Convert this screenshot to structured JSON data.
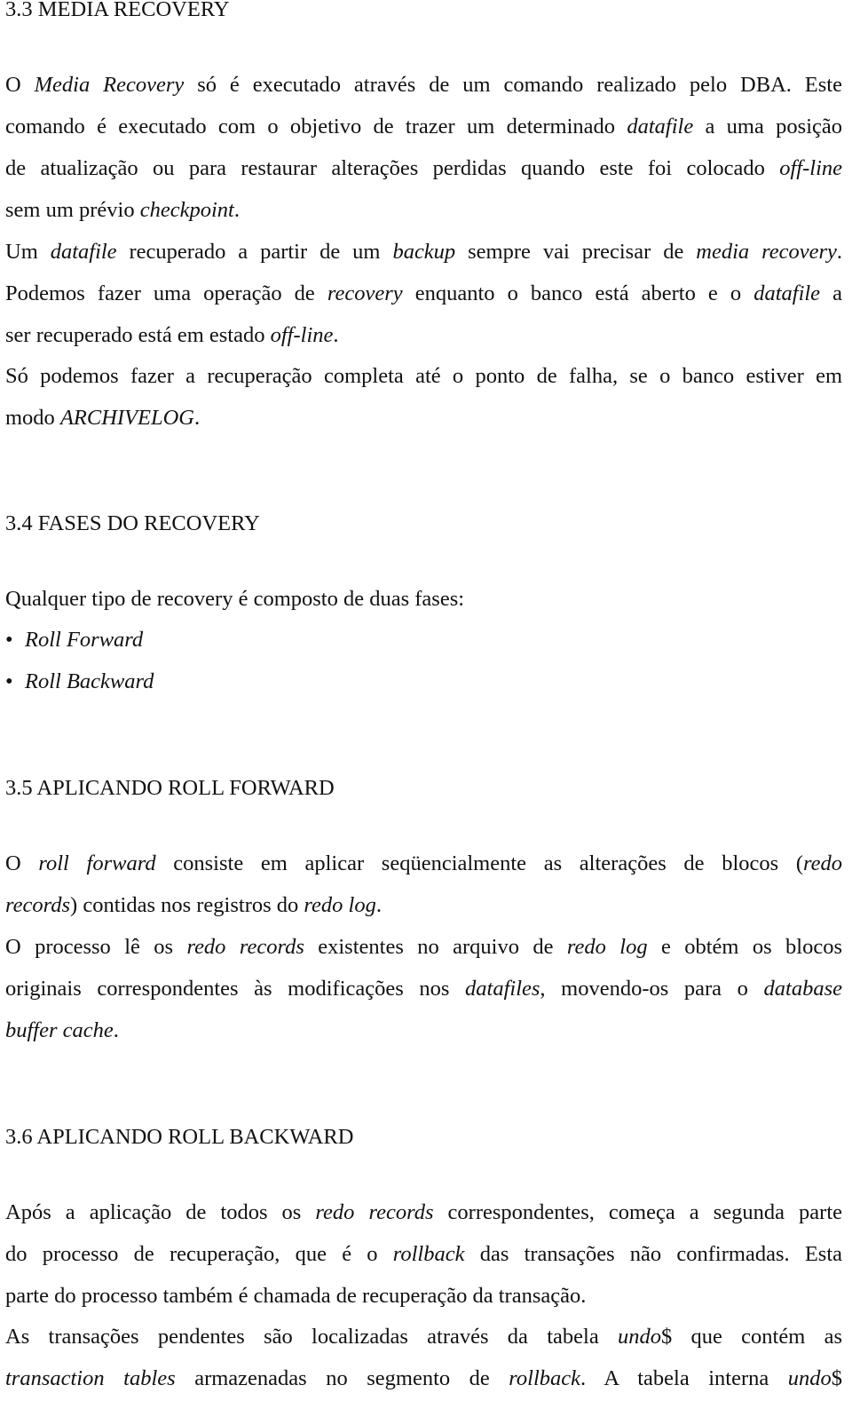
{
  "sections": [
    {
      "heading": "3.3 MEDIA RECOVERY",
      "lines": [
        [
          {
            "t": "O "
          },
          {
            "t": "Media Recovery",
            "i": true
          },
          {
            "t": " só é executado através de um comando realizado pelo DBA. Este"
          }
        ],
        [
          {
            "t": "comando é executado com o objetivo de trazer um determinado "
          },
          {
            "t": "datafile",
            "i": true
          },
          {
            "t": " a uma posição"
          }
        ],
        [
          {
            "t": "de atualização ou para restaurar alterações perdidas quando este foi colocado "
          },
          {
            "t": "off-line",
            "i": true
          }
        ],
        [
          {
            "t": "sem um prévio "
          },
          {
            "t": "checkpoint",
            "i": true
          },
          {
            "t": "."
          }
        ],
        [
          {
            "t": "Um "
          },
          {
            "t": "datafile",
            "i": true
          },
          {
            "t": " recuperado a partir de um "
          },
          {
            "t": "backup",
            "i": true
          },
          {
            "t": " sempre vai precisar de "
          },
          {
            "t": "media recovery",
            "i": true
          },
          {
            "t": "."
          }
        ],
        [
          {
            "t": "Podemos fazer uma operação de "
          },
          {
            "t": "recovery",
            "i": true
          },
          {
            "t": " enquanto o banco está aberto e o "
          },
          {
            "t": "datafile",
            "i": true
          },
          {
            "t": " a"
          }
        ],
        [
          {
            "t": "ser recuperado está em estado "
          },
          {
            "t": "off-line",
            "i": true
          },
          {
            "t": "."
          }
        ],
        [
          {
            "t": "Só podemos fazer a recuperação completa até o ponto de falha, se o banco estiver em"
          }
        ],
        [
          {
            "t": "modo "
          },
          {
            "t": "ARCHIVELOG",
            "i": true
          },
          {
            "t": "."
          }
        ]
      ]
    },
    {
      "heading": "3.4 FASES DO RECOVERY",
      "lines": [
        [
          {
            "t": "Qualquer tipo de recovery é composto de duas fases:"
          }
        ]
      ],
      "bullets": [
        "Roll Forward",
        "Roll Backward"
      ],
      "bullet_glyph": "•"
    },
    {
      "heading": "3.5 APLICANDO ROLL FORWARD",
      "lines": [
        [
          {
            "t": "O "
          },
          {
            "t": "roll forward",
            "i": true
          },
          {
            "t": " consiste em aplicar seqüencialmente as alterações de blocos ("
          },
          {
            "t": "redo",
            "i": true
          }
        ],
        [
          {
            "t": "records",
            "i": true
          },
          {
            "t": ") contidas nos registros do "
          },
          {
            "t": "redo log",
            "i": true
          },
          {
            "t": "."
          }
        ],
        [
          {
            "t": "O processo lê os "
          },
          {
            "t": "redo records",
            "i": true
          },
          {
            "t": " existentes no arquivo de "
          },
          {
            "t": "redo log",
            "i": true
          },
          {
            "t": " e obtém os blocos"
          }
        ],
        [
          {
            "t": "originais correspondentes às modificações nos "
          },
          {
            "t": "datafiles",
            "i": true
          },
          {
            "t": ", movendo-os para o "
          },
          {
            "t": "database",
            "i": true
          }
        ],
        [
          {
            "t": "buffer cache",
            "i": true
          },
          {
            "t": "."
          }
        ]
      ]
    },
    {
      "heading": "3.6 APLICANDO ROLL BACKWARD",
      "lines": [
        [
          {
            "t": "Após a aplicação de todos os "
          },
          {
            "t": "redo records",
            "i": true
          },
          {
            "t": " correspondentes, começa a segunda parte"
          }
        ],
        [
          {
            "t": "do processo de recuperação, que é o "
          },
          {
            "t": "rollback",
            "i": true
          },
          {
            "t": " das transações não confirmadas. Esta"
          }
        ],
        [
          {
            "t": "parte do processo também é chamada de recuperação da transação."
          }
        ],
        [
          {
            "t": "As transações pendentes são localizadas através da tabela "
          },
          {
            "t": "undo",
            "i": true
          },
          {
            "t": "$ que contém as"
          }
        ],
        [
          {
            "t": "transaction tables",
            "i": true
          },
          {
            "t": " armazenadas no segmento de "
          },
          {
            "t": "rollback",
            "i": true
          },
          {
            "t": ". A tabela interna "
          },
          {
            "t": "undo",
            "i": true
          },
          {
            "t": "$"
          }
        ]
      ]
    }
  ]
}
